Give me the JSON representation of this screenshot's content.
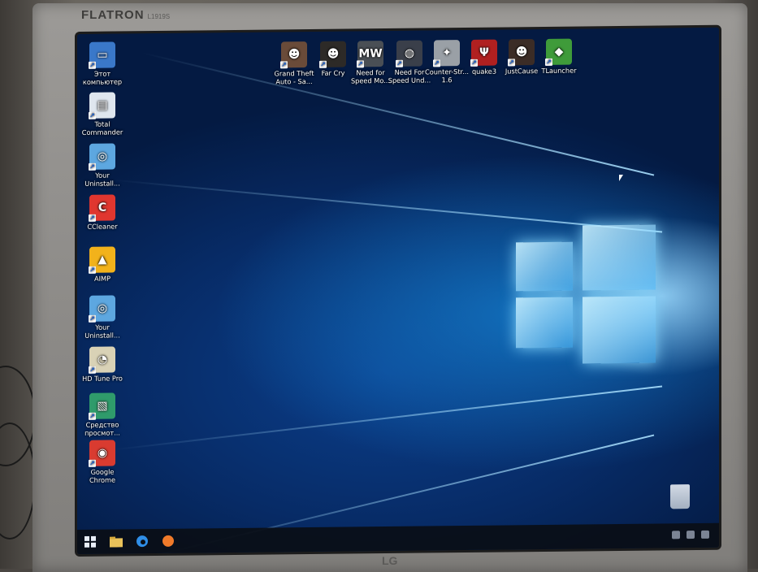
{
  "monitor": {
    "brand": "FLATRON",
    "model": "L1919S",
    "logo": "LG"
  },
  "desktop_icons_left": [
    {
      "label": "Этот компьютер",
      "icon": "computer-icon"
    },
    {
      "label": "Total Commander",
      "icon": "total-commander-icon"
    },
    {
      "label": "Your Uninstall...",
      "icon": "your-uninstaller-icon"
    },
    {
      "label": "CCleaner",
      "icon": "ccleaner-icon"
    },
    {
      "label": "AIMP",
      "icon": "aimp-icon"
    },
    {
      "label": "Your Uninstall...",
      "icon": "your-uninstaller-icon"
    },
    {
      "label": "HD Tune Pro",
      "icon": "hd-tune-icon"
    },
    {
      "label": "Средство просмот...",
      "icon": "photo-viewer-icon"
    },
    {
      "label": "Google Chrome",
      "icon": "chrome-icon"
    }
  ],
  "desktop_icons_top": [
    {
      "label": "Grand Theft Auto - Sa...",
      "icon": "gta-sa-icon"
    },
    {
      "label": "Far Cry",
      "icon": "far-cry-icon"
    },
    {
      "label": "Need for Speed Mo...",
      "icon": "nfs-mw-icon"
    },
    {
      "label": "Need For Speed Und...",
      "icon": "nfs-underground-icon"
    },
    {
      "label": "Counter-Str... 1.6",
      "icon": "counter-strike-icon"
    },
    {
      "label": "quake3",
      "icon": "quake3-icon"
    },
    {
      "label": "JustCause",
      "icon": "just-cause-icon"
    },
    {
      "label": "TLauncher",
      "icon": "tlauncher-icon"
    }
  ],
  "taskbar": {
    "buttons": [
      {
        "name": "start-button",
        "icon": "windows-logo-icon"
      },
      {
        "name": "file-explorer-button",
        "icon": "folder-icon"
      },
      {
        "name": "edge-button",
        "icon": "edge-icon"
      },
      {
        "name": "media-button",
        "icon": "aimp-taskbar-icon"
      }
    ]
  },
  "colors": {
    "wallpaper_dark": "#041a42",
    "wallpaper_glow": "#50beff",
    "taskbar": "#0a0e16"
  }
}
